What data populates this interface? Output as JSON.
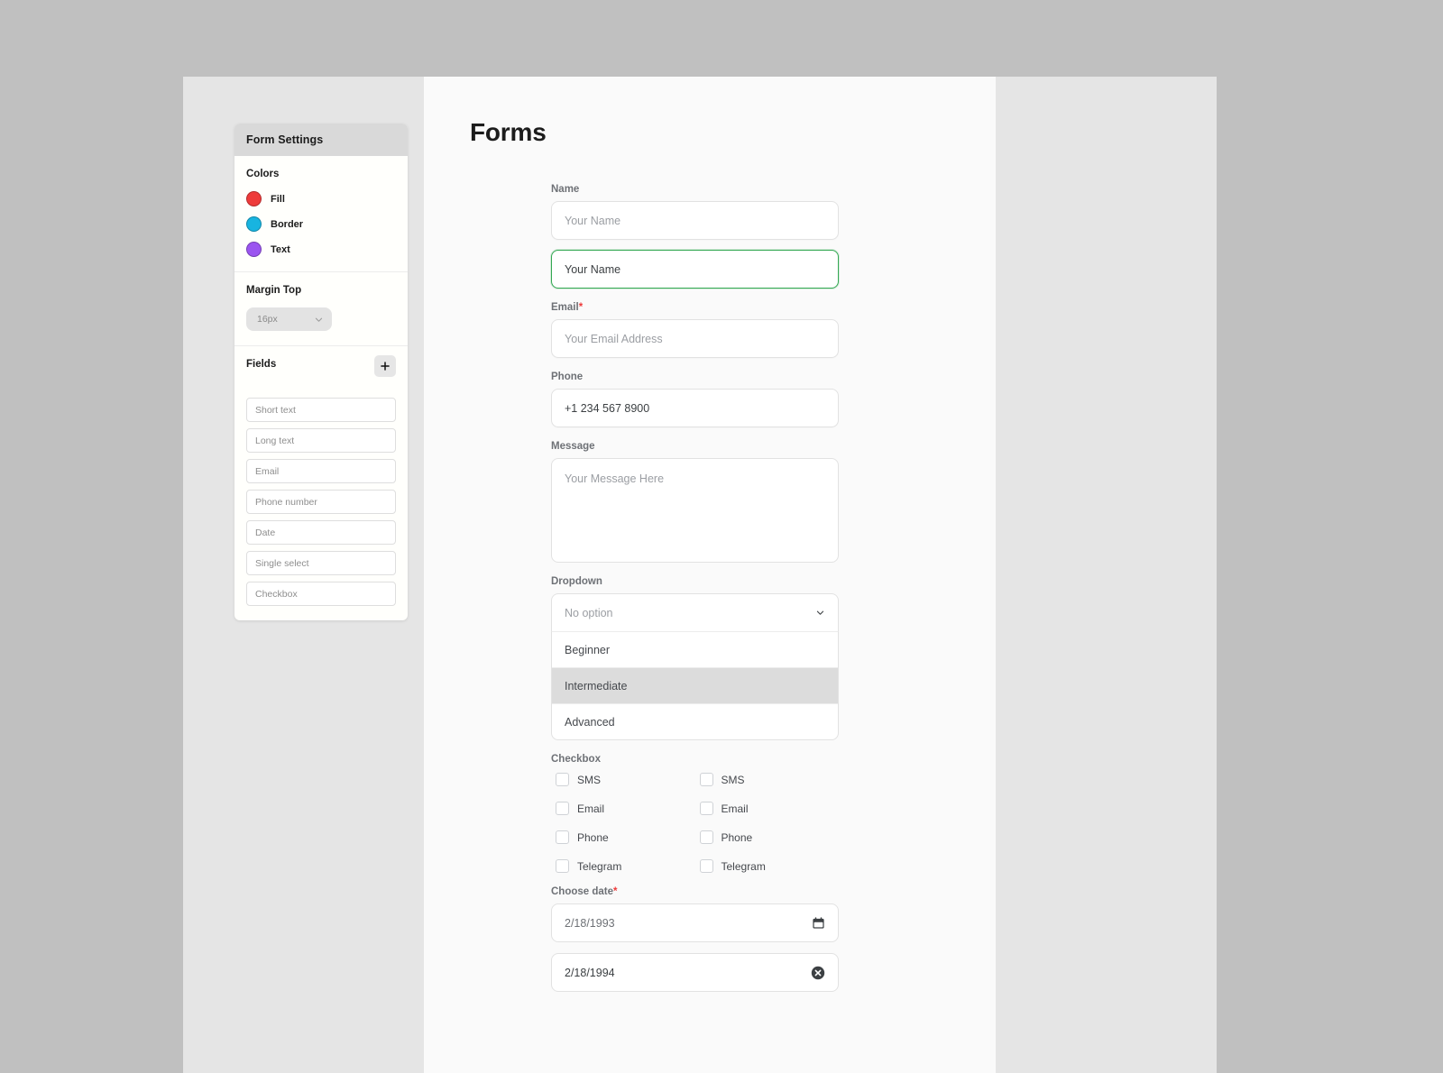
{
  "sidebar": {
    "panel_title": "Form Settings",
    "colors": {
      "title": "Colors",
      "items": [
        {
          "label": "Fill",
          "color": "#ee3b3b"
        },
        {
          "label": "Border",
          "color": "#18b4e0"
        },
        {
          "label": "Text",
          "color": "#9b55f0"
        }
      ]
    },
    "margin_top": {
      "title": "Margin Top",
      "value": "16px",
      "chevron": "chevron-down-icon"
    },
    "fields": {
      "title": "Fields",
      "add_label": "+",
      "items": [
        "Short text",
        "Long text",
        "Email",
        "Phone number",
        "Date",
        "Single select",
        "Checkbox"
      ]
    }
  },
  "main": {
    "title": "Forms",
    "name": {
      "label": "Name",
      "placeholder": "Your Name",
      "focused_value": "Your Name"
    },
    "email": {
      "label": "Email",
      "required_mark": "*",
      "placeholder": "Your Email Address"
    },
    "phone": {
      "label": "Phone",
      "value": "+1 234 567 8900"
    },
    "message": {
      "label": "Message",
      "placeholder": "Your Message Here"
    },
    "dropdown": {
      "label": "Dropdown",
      "selected": "No option",
      "chevron": "chevron-down-icon",
      "options": [
        {
          "label": "Beginner",
          "highlighted": false
        },
        {
          "label": "Intermediate",
          "highlighted": true
        },
        {
          "label": "Advanced",
          "highlighted": false
        }
      ]
    },
    "checkbox": {
      "label": "Checkbox",
      "column_left": [
        "SMS",
        "Email",
        "Phone",
        "Telegram"
      ],
      "column_right": [
        "SMS",
        "Email",
        "Phone",
        "Telegram"
      ]
    },
    "date": {
      "label": "Choose date",
      "required_mark": "*",
      "value_first": "2/18/1993",
      "value_second": "2/18/1994",
      "calendar_icon": "calendar-icon",
      "clear_icon": "clear-circle-icon"
    }
  }
}
